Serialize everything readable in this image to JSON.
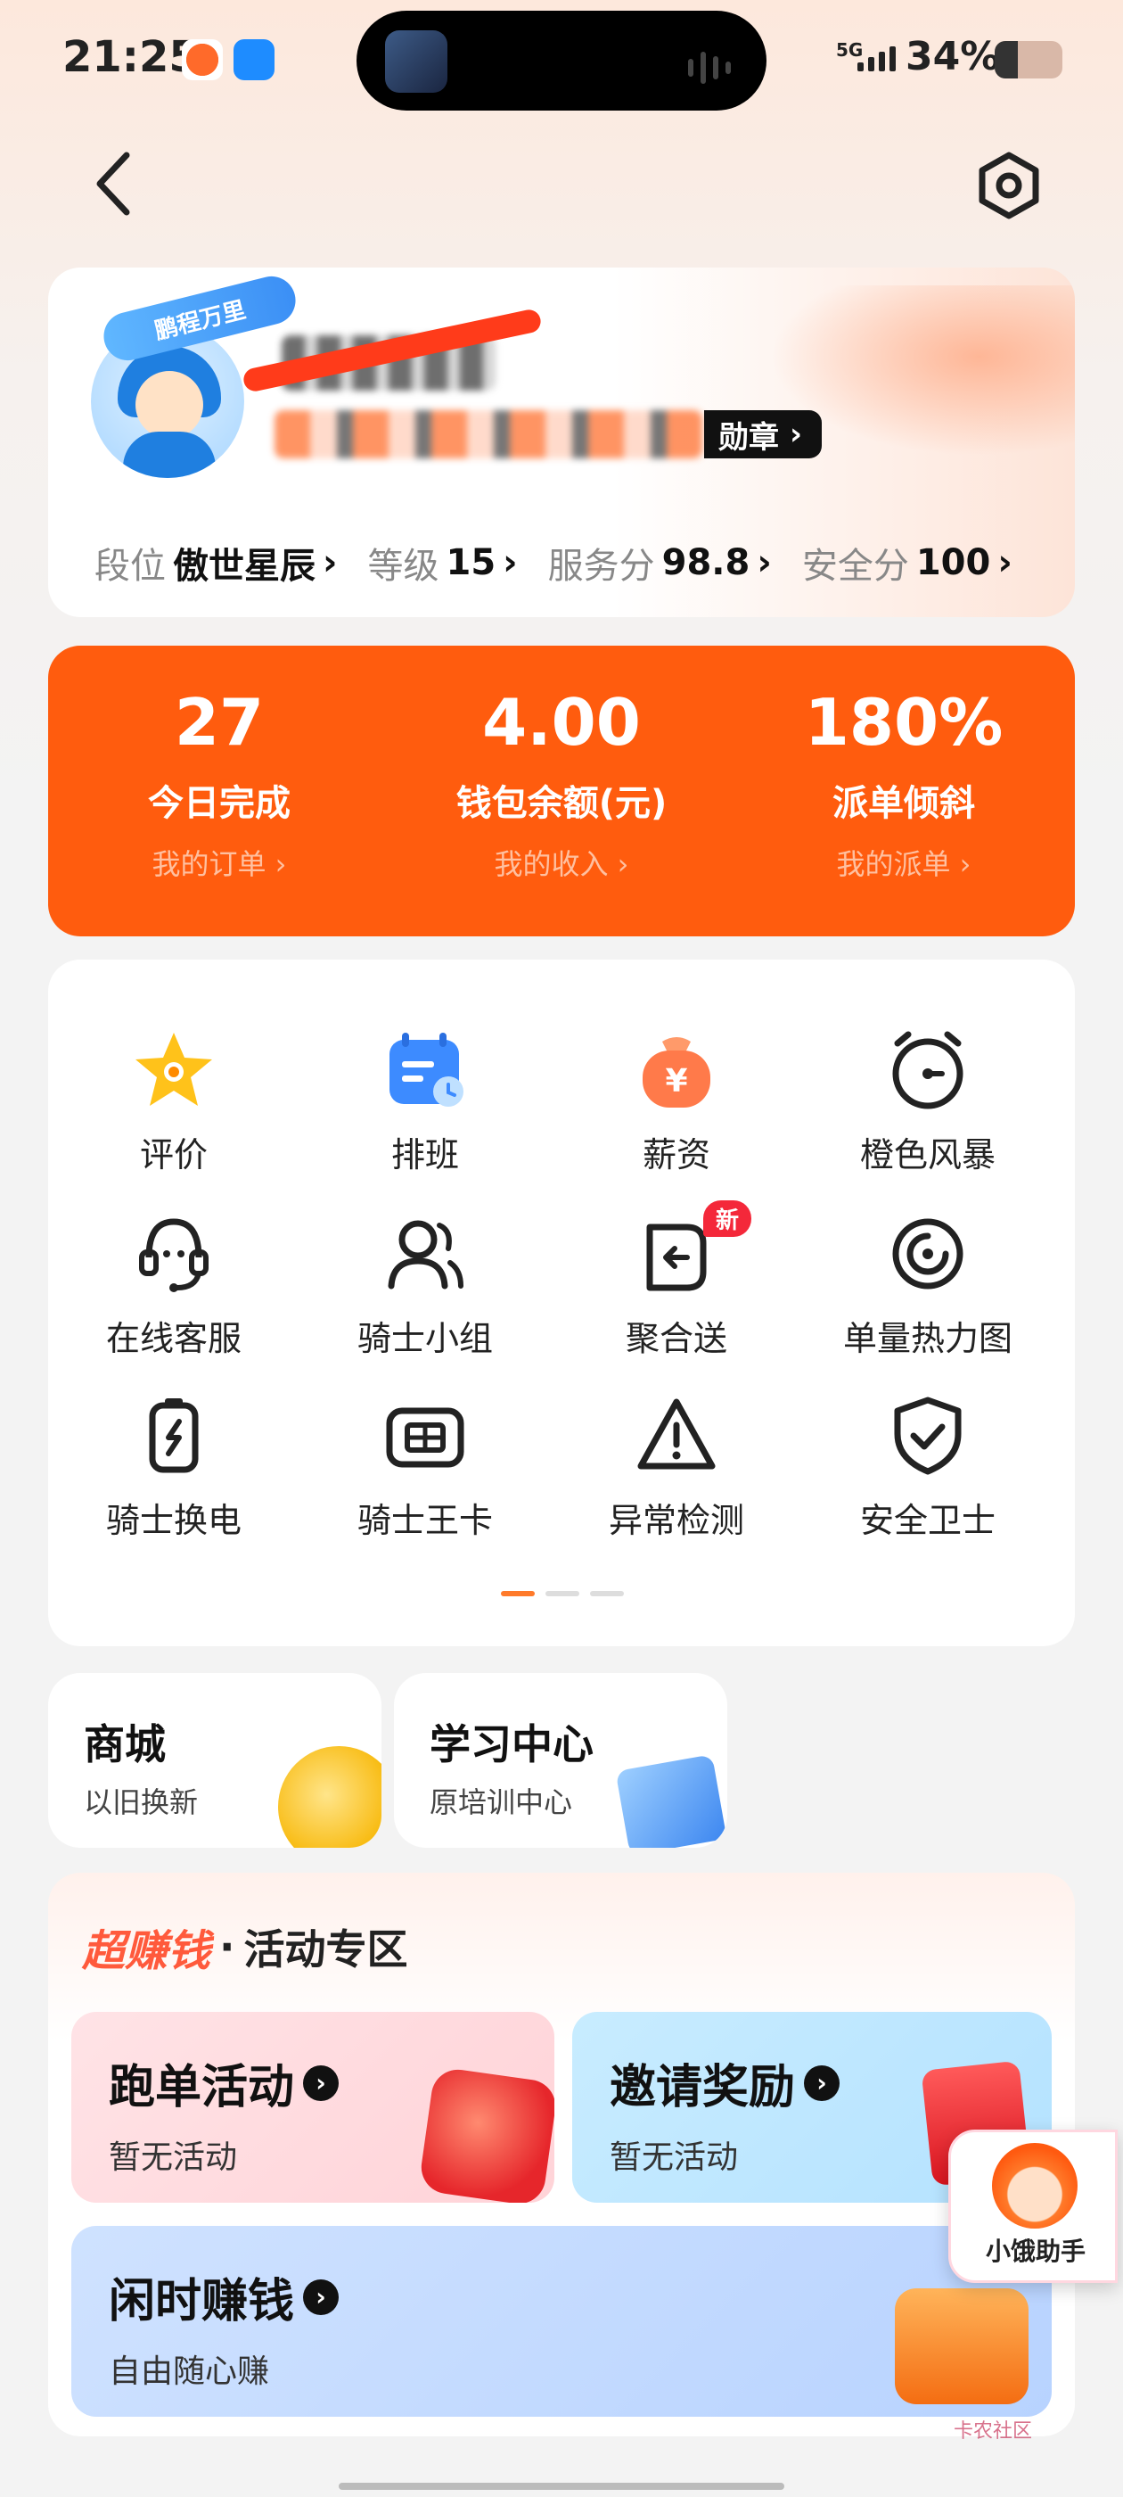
{
  "status_bar": {
    "time": "21:25",
    "network": "5G",
    "battery_percent": "34%",
    "battery_level": 0.34
  },
  "nav": {
    "back_icon": "chevron-left-icon",
    "settings_icon": "hexagon-settings-icon"
  },
  "profile": {
    "avatar_badge": "鹏程万里",
    "medal_label": "勋章",
    "stats": [
      {
        "label": "段位",
        "value": "傲世星辰"
      },
      {
        "label": "等级",
        "value": "15"
      },
      {
        "label": "服务分",
        "value": "98.8"
      },
      {
        "label": "安全分",
        "value": "100"
      }
    ]
  },
  "summary": [
    {
      "value": "27",
      "label": "今日完成",
      "link": "我的订单 ›"
    },
    {
      "value": "4.00",
      "label": "钱包余额(元)",
      "link": "我的收入 ›"
    },
    {
      "value": "180%",
      "label": "派单倾斜",
      "link": "我的派单 ›"
    }
  ],
  "tools": [
    {
      "label": "评价",
      "icon": "star-icon"
    },
    {
      "label": "排班",
      "icon": "calendar-icon"
    },
    {
      "label": "薪资",
      "icon": "money-bag-icon"
    },
    {
      "label": "橙色风暴",
      "icon": "alarm-clock-icon"
    },
    {
      "label": "在线客服",
      "icon": "headset-icon"
    },
    {
      "label": "骑士小组",
      "icon": "group-icon"
    },
    {
      "label": "聚合送",
      "icon": "merge-delivery-icon",
      "badge": "新"
    },
    {
      "label": "单量热力图",
      "icon": "heatmap-target-icon"
    },
    {
      "label": "骑士换电",
      "icon": "battery-swap-icon"
    },
    {
      "label": "骑士王卡",
      "icon": "sim-card-icon"
    },
    {
      "label": "异常检测",
      "icon": "warning-triangle-icon"
    },
    {
      "label": "安全卫士",
      "icon": "shield-check-icon"
    }
  ],
  "mall": {
    "title": "商城",
    "subtitle": "以旧换新"
  },
  "study": {
    "title": "学习中心",
    "subtitle": "原培训中心"
  },
  "activities": {
    "hot_label": "超赚钱",
    "zone_label": "活动专区",
    "items": [
      {
        "title": "跑单活动",
        "subtitle": "暂无活动"
      },
      {
        "title": "邀请奖励",
        "subtitle": "暂无活动"
      },
      {
        "title": "闲时赚钱",
        "subtitle": "自由随心赚"
      }
    ]
  },
  "helper": {
    "label": "小饿助手"
  },
  "watermark": "卡农社区"
}
